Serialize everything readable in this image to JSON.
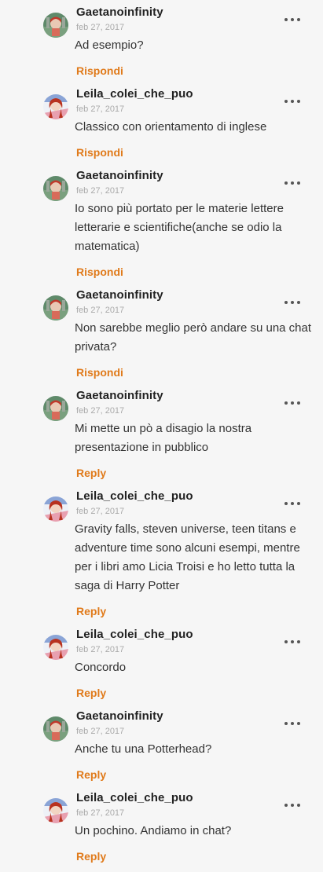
{
  "comments": [
    {
      "user": "Gaetanoinfinity",
      "date": "feb 27, 2017",
      "text": "Ad esempio?",
      "reply": "Rispondi",
      "avatar": "green"
    },
    {
      "user": "Leila_colei_che_puo",
      "date": "feb 27, 2017",
      "text": "Classico con orientamento di inglese",
      "reply": "Rispondi",
      "avatar": "pink"
    },
    {
      "user": "Gaetanoinfinity",
      "date": "feb 27, 2017",
      "text": "Io sono più portato per le materie lettere letterarie e scientifiche(anche se odio la matematica)",
      "reply": "Rispondi",
      "avatar": "green"
    },
    {
      "user": "Gaetanoinfinity",
      "date": "feb 27, 2017",
      "text": "Non sarebbe meglio però andare su una chat privata?",
      "reply": "Rispondi",
      "avatar": "green"
    },
    {
      "user": "Gaetanoinfinity",
      "date": "feb 27, 2017",
      "text": "Mi mette un pò a disagio la nostra presentazione in pubblico",
      "reply": "Reply",
      "avatar": "green"
    },
    {
      "user": "Leila_colei_che_puo",
      "date": "feb 27, 2017",
      "text": "Gravity falls, steven universe, teen titans e adventure time sono alcuni esempi, mentre per i libri amo Licia Troisi e ho letto tutta la saga di Harry Potter",
      "reply": "Reply",
      "avatar": "pink"
    },
    {
      "user": "Leila_colei_che_puo",
      "date": "feb 27, 2017",
      "text": "Concordo",
      "reply": "Reply",
      "avatar": "pink"
    },
    {
      "user": "Gaetanoinfinity",
      "date": "feb 27, 2017",
      "text": "Anche tu una Potterhead?",
      "reply": "Reply",
      "avatar": "green"
    },
    {
      "user": "Leila_colei_che_puo",
      "date": "feb 27, 2017",
      "text": "Un pochino. Andiamo in chat?",
      "reply": "Reply",
      "avatar": "pink"
    }
  ],
  "icons": {
    "more": "more-options-icon"
  }
}
